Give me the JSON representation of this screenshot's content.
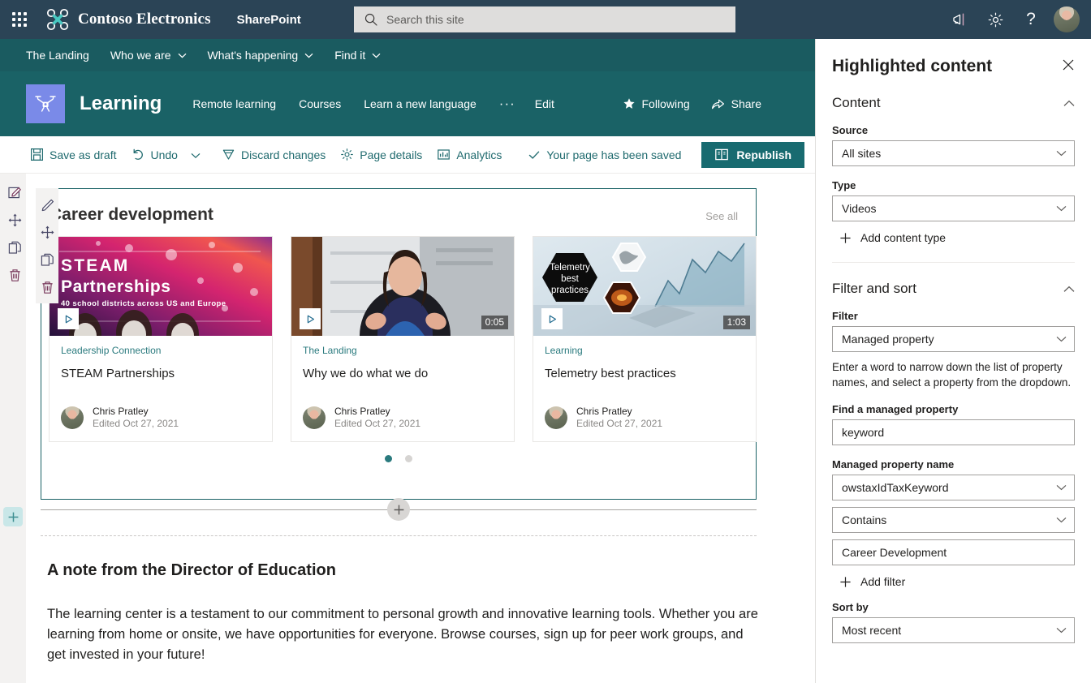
{
  "suitebar": {
    "waffle_label": "App launcher",
    "brand": "Contoso Electronics",
    "app_name": "SharePoint",
    "search_placeholder": "Search this site",
    "search_value": "",
    "icons": [
      "megaphone-icon",
      "gear-icon",
      "help-icon",
      "avatar"
    ],
    "help_glyph": "?",
    "bg": "#2b4456"
  },
  "sitenav": {
    "bg": "#1a5b60",
    "items": [
      {
        "label": "The Landing",
        "has_chevron": false
      },
      {
        "label": "Who we are",
        "has_chevron": true
      },
      {
        "label": "What's happening",
        "has_chevron": true
      },
      {
        "label": "Find it",
        "has_chevron": true
      }
    ]
  },
  "siteheader": {
    "bg": "#1a6266",
    "logo_bg": "#7a8ae8",
    "title": "Learning",
    "links": [
      "Remote learning",
      "Courses",
      "Learn a new language"
    ],
    "overflow": "···",
    "edit": "Edit",
    "following": "Following",
    "share": "Share"
  },
  "commandbar": {
    "save_as_draft": "Save as draft",
    "undo": "Undo",
    "discard_changes": "Discard changes",
    "page_details": "Page details",
    "analytics": "Analytics",
    "status": "Your page has been saved",
    "republish": "Republish",
    "republish_bg": "#186b70"
  },
  "rails": {
    "rail_a": [
      "edit-icon",
      "move-icon",
      "duplicate-icon",
      "delete-icon"
    ],
    "rail_b": [
      "edit-icon",
      "move-icon",
      "duplicate-icon",
      "delete-icon"
    ],
    "add_section": "+"
  },
  "webpart": {
    "title": "Career development",
    "see_all": "See all",
    "cards": [
      {
        "site": "Leadership Connection",
        "name": "STEAM Partnerships",
        "author": "Chris Pratley",
        "edited": "Edited Oct 27, 2021",
        "duration": "",
        "thumb_title": "STEAM",
        "thumb_title2": "Partnerships",
        "thumb_sub": "40 school districts across US and Europe"
      },
      {
        "site": "The Landing",
        "name": "Why we do what we do",
        "author": "Chris Pratley",
        "edited": "Edited Oct 27, 2021",
        "duration": "0:05",
        "thumb_title": "",
        "thumb_title2": "",
        "thumb_sub": ""
      },
      {
        "site": "Learning",
        "name": "Telemetry best practices",
        "author": "Chris Pratley",
        "edited": "Edited Oct 27, 2021",
        "duration": "1:03",
        "thumb_title": "Telemetry",
        "thumb_title2": "best",
        "thumb_sub": "practices"
      }
    ],
    "pager": {
      "count": 2,
      "active": 0,
      "active_color": "#2a7a7e",
      "inactive_color": "#d6d4d2"
    }
  },
  "note": {
    "heading": "A note from the Director of Education",
    "body": "The learning center is a testament to our commitment to personal growth and innovative learning tools. Whether you are learning from home or onsite, we have opportunities for everyone. Browse courses, sign up for peer work groups, and get invested in your future!"
  },
  "panel": {
    "title": "Highlighted content",
    "close": "✕",
    "content": {
      "group_title": "Content",
      "source_label": "Source",
      "source_value": "All sites",
      "type_label": "Type",
      "type_value": "Videos",
      "add_content_type": "Add content type"
    },
    "filter": {
      "group_title": "Filter and sort",
      "filter_label": "Filter",
      "filter_value": "Managed property",
      "hint": "Enter a word to narrow down the list of property names, and select a property from the dropdown.",
      "find_label": "Find a managed property",
      "find_value": "keyword",
      "prop_label": "Managed property name",
      "prop_value": "owstaxIdTaxKeyword",
      "operator_value": "Contains",
      "term_value": "Career Development",
      "add_filter": "Add filter",
      "sort_label": "Sort by",
      "sort_value": "Most recent"
    }
  }
}
